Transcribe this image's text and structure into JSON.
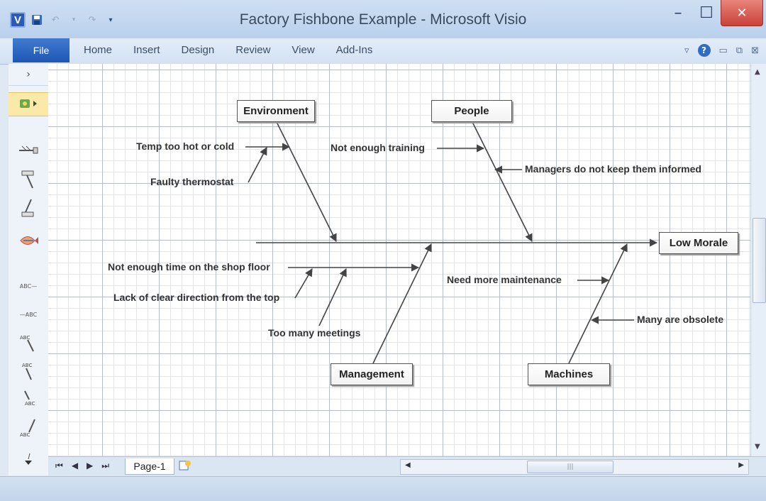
{
  "window": {
    "title": "Factory Fishbone Example - Microsoft Visio",
    "app_icon": "V",
    "minimize_icon": "–",
    "maximize_icon": "☐",
    "close_icon": "✕"
  },
  "ribbon": {
    "file": "File",
    "tabs": [
      "Home",
      "Insert",
      "Design",
      "Review",
      "View",
      "Add-Ins"
    ]
  },
  "diagram": {
    "effect": "Low Morale",
    "categories": {
      "environment": "Environment",
      "people": "People",
      "management": "Management",
      "machines": "Machines"
    },
    "causes": {
      "temp": "Temp too hot or cold",
      "thermostat": "Faulty thermostat",
      "training": "Not enough training",
      "managers": "Managers do not keep them informed",
      "shop_floor": "Not enough time on the shop floor",
      "direction": "Lack of clear direction from the top",
      "meetings": "Too many meetings",
      "maintenance": "Need more maintenance",
      "obsolete": "Many are obsolete"
    }
  },
  "status": {
    "page_tab": "Page-1"
  }
}
